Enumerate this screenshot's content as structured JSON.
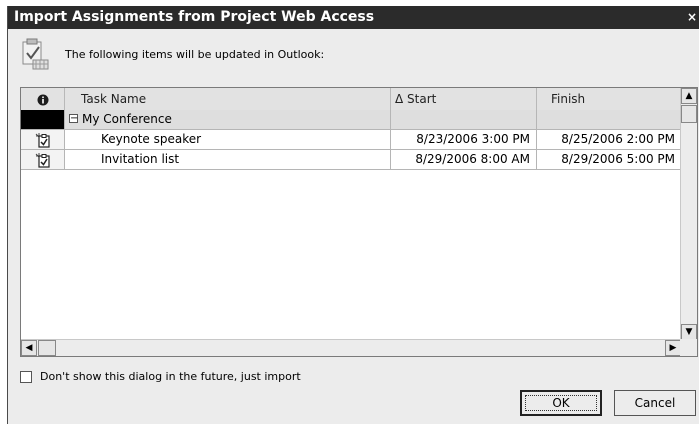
{
  "dialog": {
    "title": "Import Assignments from Project Web Access",
    "close_glyph": "×",
    "message": "The following items will be updated in Outlook:",
    "header_icon": "checklist-icon"
  },
  "grid": {
    "columns": {
      "icon": "info-icon",
      "task_name": "Task Name",
      "start": "Δ Start",
      "finish": "Finish"
    },
    "group": {
      "expander": "−",
      "name": "My Conference"
    },
    "tasks": [
      {
        "icon": "task-checkbox-icon",
        "name": "Keynote speaker",
        "start": "8/23/2006 3:00 PM",
        "finish": "8/25/2006 2:00 PM"
      },
      {
        "icon": "task-checkbox-icon",
        "name": "Invitation list",
        "start": "8/29/2006 8:00 AM",
        "finish": "8/29/2006 5:00 PM"
      }
    ]
  },
  "footer": {
    "checkbox_label": "Don't show this dialog in the future, just import",
    "checkbox_checked": false,
    "ok_label": "OK",
    "cancel_label": "Cancel"
  }
}
